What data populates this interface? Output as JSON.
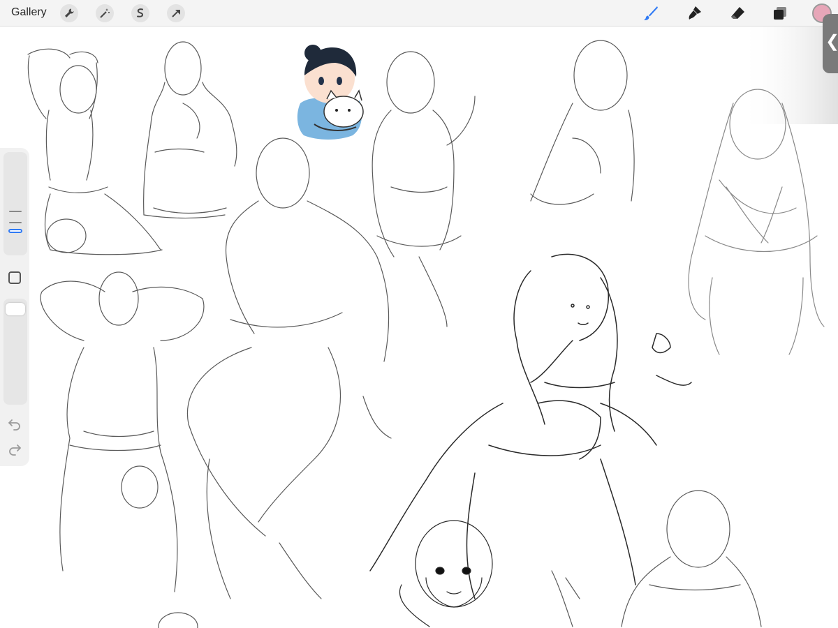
{
  "toolbar": {
    "gallery_label": "Gallery",
    "left_tools": [
      "wrench-icon",
      "magic-wand-icon",
      "selection-icon",
      "transform-arrow-icon"
    ],
    "right_tools": [
      "brush-icon",
      "smudge-icon",
      "eraser-icon",
      "layers-icon"
    ],
    "brush_active_color": "#2f7af5",
    "color_swatch": "#e7a6b8"
  },
  "sidebar": {
    "size_slider": "brush-size-slider",
    "opacity_slider": "brush-opacity-slider",
    "modify_button": "modify-square-button",
    "undo": "undo-icon",
    "redo": "redo-icon"
  },
  "side_handle_glyph": "❮"
}
